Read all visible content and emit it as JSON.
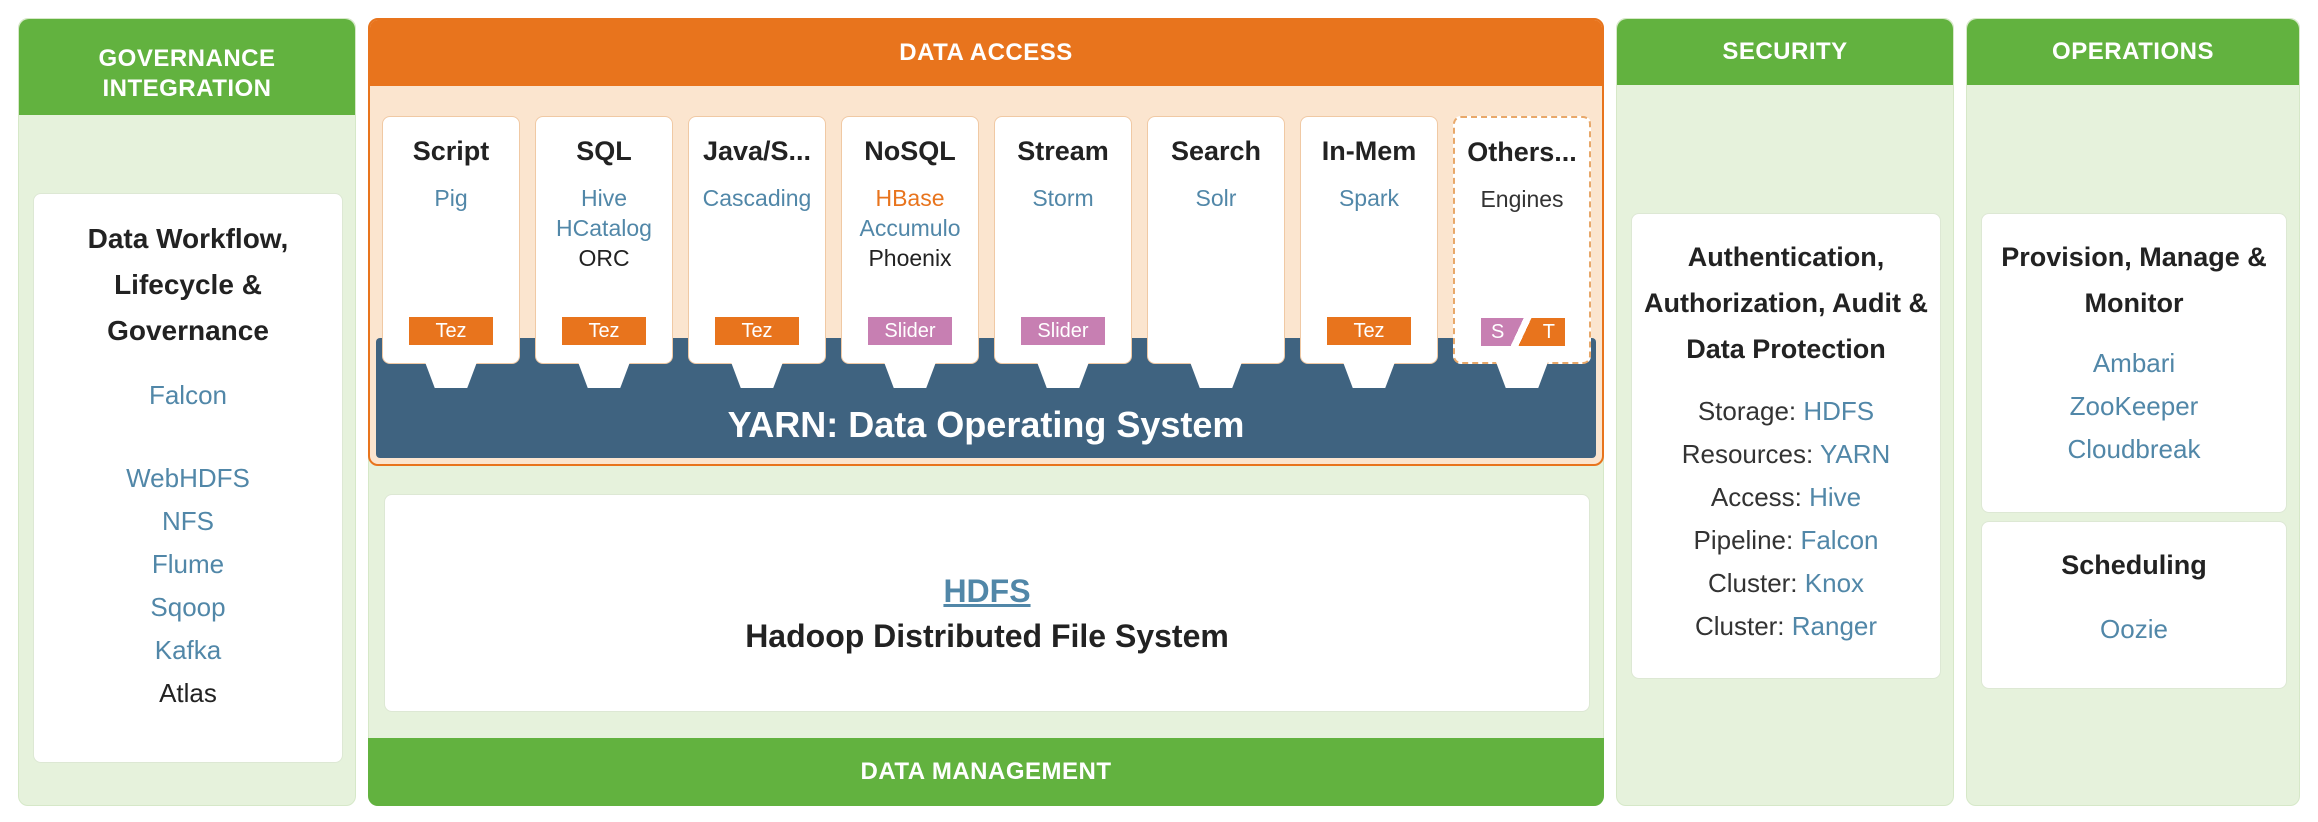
{
  "governance": {
    "header_line1": "GOVERNANCE",
    "header_line2": "INTEGRATION",
    "card_title_line1": "Data Workflow,",
    "card_title_line2": "Lifecycle &",
    "card_title_line3": "Governance",
    "items": [
      "Falcon",
      "WebHDFS",
      "NFS",
      "Flume",
      "Sqoop",
      "Kafka",
      "Atlas"
    ]
  },
  "data_access": {
    "header": "DATA ACCESS",
    "engines": [
      {
        "title": "Script",
        "sub": [
          "Pig"
        ],
        "badge": "Tez"
      },
      {
        "title": "SQL",
        "sub": [
          "Hive",
          "HCatalog",
          "ORC"
        ],
        "badge": "Tez"
      },
      {
        "title": "Java/S...",
        "sub": [
          "Cascading"
        ],
        "badge": "Tez"
      },
      {
        "title": "NoSQL",
        "sub": [
          "HBase",
          "Accumulo",
          "Phoenix"
        ],
        "badge": "Slider"
      },
      {
        "title": "Stream",
        "sub": [
          "Storm"
        ],
        "badge": "Slider"
      },
      {
        "title": "Search",
        "sub": [
          "Solr"
        ],
        "badge": ""
      },
      {
        "title": "In-Mem",
        "sub": [
          "Spark"
        ],
        "badge": "Tez"
      },
      {
        "title": "Others...",
        "sub": [
          "Engines"
        ],
        "badge_left": "S",
        "badge_right": "T"
      }
    ],
    "yarn": "YARN: Data Operating System"
  },
  "hdfs": {
    "title": "HDFS",
    "subtitle": "Hadoop Distributed File System"
  },
  "data_management": {
    "label": "DATA MANAGEMENT"
  },
  "security": {
    "header": "SECURITY",
    "card_title_line1": "Authentication,",
    "card_title_line2": "Authorization, Audit &",
    "card_title_line3": "Data Protection",
    "rows": [
      {
        "k": "Storage:",
        "v": "HDFS"
      },
      {
        "k": "Resources:",
        "v": "YARN"
      },
      {
        "k": "Access:",
        "v": "Hive"
      },
      {
        "k": "Pipeline:",
        "v": "Falcon"
      },
      {
        "k": "Cluster:",
        "v": "Knox"
      },
      {
        "k": "Cluster:",
        "v": "Ranger"
      }
    ]
  },
  "operations": {
    "header": "OPERATIONS",
    "card1_title_line1": "Provision, Manage &",
    "card1_title_line2": "Monitor",
    "card1_items": [
      "Ambari",
      "ZooKeeper",
      "Cloudbreak"
    ],
    "card2_title": "Scheduling",
    "card2_items": [
      "Oozie"
    ]
  },
  "colors": {
    "green": "#62b23f",
    "orange": "#e8741d",
    "yarn_blue": "#3f6380",
    "link_blue": "#5187a8",
    "slider_pink": "#c77fb2"
  }
}
